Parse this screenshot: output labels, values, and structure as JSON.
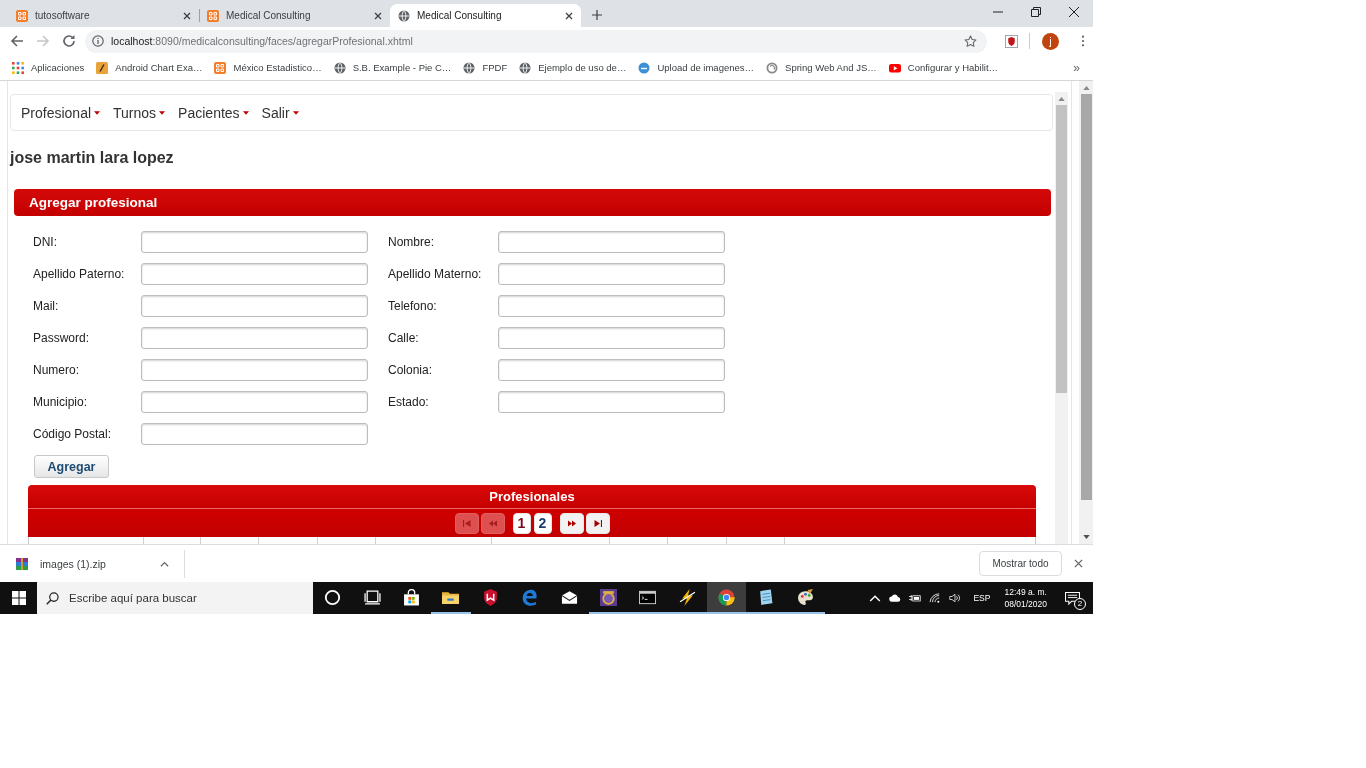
{
  "browser": {
    "tabs": [
      {
        "title": "tutosoftware",
        "kind": "xampp",
        "selected": false
      },
      {
        "title": "Medical Consulting",
        "kind": "xampp",
        "selected": false
      },
      {
        "title": "Medical Consulting",
        "kind": "globe",
        "selected": true
      }
    ],
    "back": {
      "disabled": false
    },
    "forward": {
      "disabled": true
    },
    "url_host": "localhost",
    "url_rest": ":8090/medicalconsulting/faces/agregarProfesional.xhtml",
    "profile_initial": "j",
    "bookmarks": [
      {
        "label": "Aplicaciones",
        "kind": "apps"
      },
      {
        "label": "Android Chart Exa…",
        "kind": "tile"
      },
      {
        "label": "México Estadistico…",
        "kind": "xampp"
      },
      {
        "label": "S.B. Example - Pie C…",
        "kind": "globe"
      },
      {
        "label": "FPDF",
        "kind": "globe"
      },
      {
        "label": "Ejemplo de uso de…",
        "kind": "globe"
      },
      {
        "label": "Upload de imagenes…",
        "kind": "upload"
      },
      {
        "label": "Spring Web And JS…",
        "kind": "spring"
      },
      {
        "label": "Configurar y Habilit…",
        "kind": "video"
      }
    ],
    "bookmarks_overflow": "»"
  },
  "page": {
    "menu": [
      {
        "label": "Profesional"
      },
      {
        "label": "Turnos"
      },
      {
        "label": "Pacientes"
      },
      {
        "label": "Salir"
      }
    ],
    "user_name": "jose martin lara lopez",
    "form_panel": {
      "title": "Agregar profesional",
      "fields": [
        {
          "label": "DNI:"
        },
        {
          "label": "Nombre:"
        },
        {
          "label": "Apellido Paterno:"
        },
        {
          "label": "Apellido Materno:"
        },
        {
          "label": "Mail:"
        },
        {
          "label": "Telefono:"
        },
        {
          "label": "Password:"
        },
        {
          "label": "Calle:"
        },
        {
          "label": "Numero:"
        },
        {
          "label": "Colonia:"
        },
        {
          "label": "Municipio:"
        },
        {
          "label": "Estado:"
        },
        {
          "label": "Código Postal:"
        }
      ],
      "submit": "Agregar"
    },
    "table_panel": {
      "title": "Profesionales",
      "paginator": {
        "first": {
          "disabled": true
        },
        "previous": {
          "disabled": true
        },
        "pages": [
          {
            "label": "1",
            "selected": true
          },
          {
            "label": "2",
            "selected": false
          }
        ],
        "next": {
          "disabled": false
        },
        "last": {
          "disabled": false
        }
      }
    }
  },
  "downloads_bar": {
    "file_name": "images (1).zip",
    "show_all": "Mostrar todo"
  },
  "taskbar": {
    "search_placeholder": "Escribe aquí para buscar",
    "apps": [
      {
        "kind": "cortana",
        "running": false,
        "selected": false
      },
      {
        "kind": "task_view",
        "running": false,
        "selected": false
      },
      {
        "kind": "store",
        "running": false,
        "selected": false
      },
      {
        "kind": "explorer",
        "running": true,
        "selected": false
      },
      {
        "kind": "shield",
        "running": false,
        "selected": false
      },
      {
        "kind": "edge",
        "running": false,
        "selected": false
      },
      {
        "kind": "mail",
        "running": false,
        "selected": false
      },
      {
        "kind": "badge",
        "running": true,
        "selected": false
      },
      {
        "kind": "terminal",
        "running": true,
        "selected": false
      },
      {
        "kind": "bolt",
        "running": true,
        "selected": false
      },
      {
        "kind": "chrome",
        "running": true,
        "selected": true
      },
      {
        "kind": "notepad",
        "running": true,
        "selected": false
      },
      {
        "kind": "paint",
        "running": true,
        "selected": false
      }
    ],
    "language": "ESP",
    "time": "12:49 a. m.",
    "date": "08/01/2020",
    "notification_count": "2"
  }
}
